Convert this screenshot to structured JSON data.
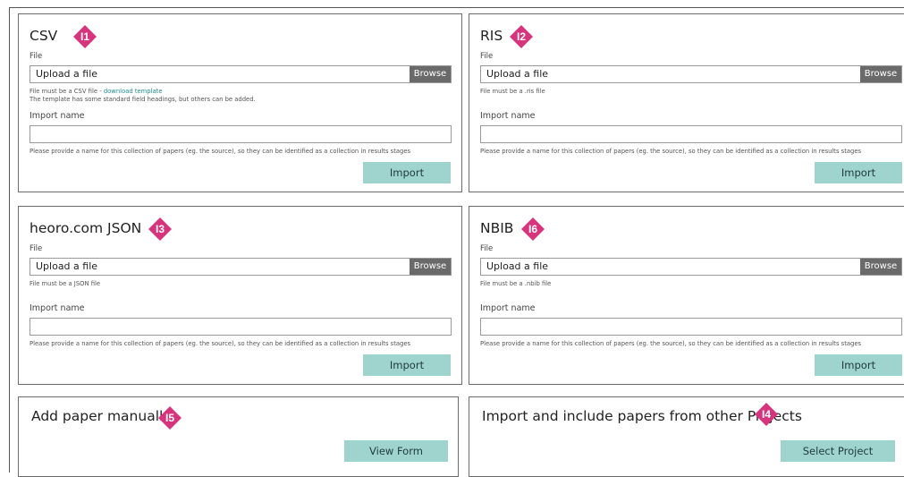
{
  "badge_color": "#d6357d",
  "button_color": "#9fd3ce",
  "browse_color": "#6a6a6a",
  "link_color": "#1f8c92",
  "csv": {
    "title": "CSV",
    "badge": "I1",
    "file_label": "File",
    "file_placeholder": "Upload a file",
    "browse": "Browse",
    "help_prefix": "File must be a CSV file - ",
    "help_link": "download template",
    "help_line2": "The template has some standard field headings, but others can be added.",
    "import_name_label": "Import name",
    "import_name_value": "",
    "import_help": "Please provide a name for this collection of papers (eg. the source), so they can be identified as a collection in results stages",
    "import_button": "Import"
  },
  "ris": {
    "title": "RIS",
    "badge": "I2",
    "file_label": "File",
    "file_placeholder": "Upload a file",
    "browse": "Browse",
    "help": "File must be a .ris file",
    "import_name_label": "Import name",
    "import_name_value": "",
    "import_help": "Please provide a name for this collection of papers (eg. the source), so they can be identified as a collection in results stages",
    "import_button": "Import"
  },
  "json": {
    "title": "heoro.com JSON",
    "badge": "I3",
    "file_label": "File",
    "file_placeholder": "Upload a file",
    "browse": "Browse",
    "help": "File must be a JSON file",
    "import_name_label": "Import name",
    "import_name_value": "",
    "import_help": "Please provide a name for this collection of papers (eg. the source), so they can be identified as a collection in results stages",
    "import_button": "Import"
  },
  "nbib": {
    "title": "NBIB",
    "badge": "I6",
    "file_label": "File",
    "file_placeholder": "Upload a file",
    "browse": "Browse",
    "help": "File must be a .nbib file",
    "import_name_label": "Import name",
    "import_name_value": "",
    "import_help": "Please provide a name for this collection of papers (eg. the source), so they can be identified as a collection in results stages",
    "import_button": "Import"
  },
  "manual": {
    "title": "Add paper manually",
    "badge": "I5",
    "button": "View Form"
  },
  "projects": {
    "title": "Import and include papers from other Projects",
    "badge": "I4",
    "button": "Select Project"
  }
}
